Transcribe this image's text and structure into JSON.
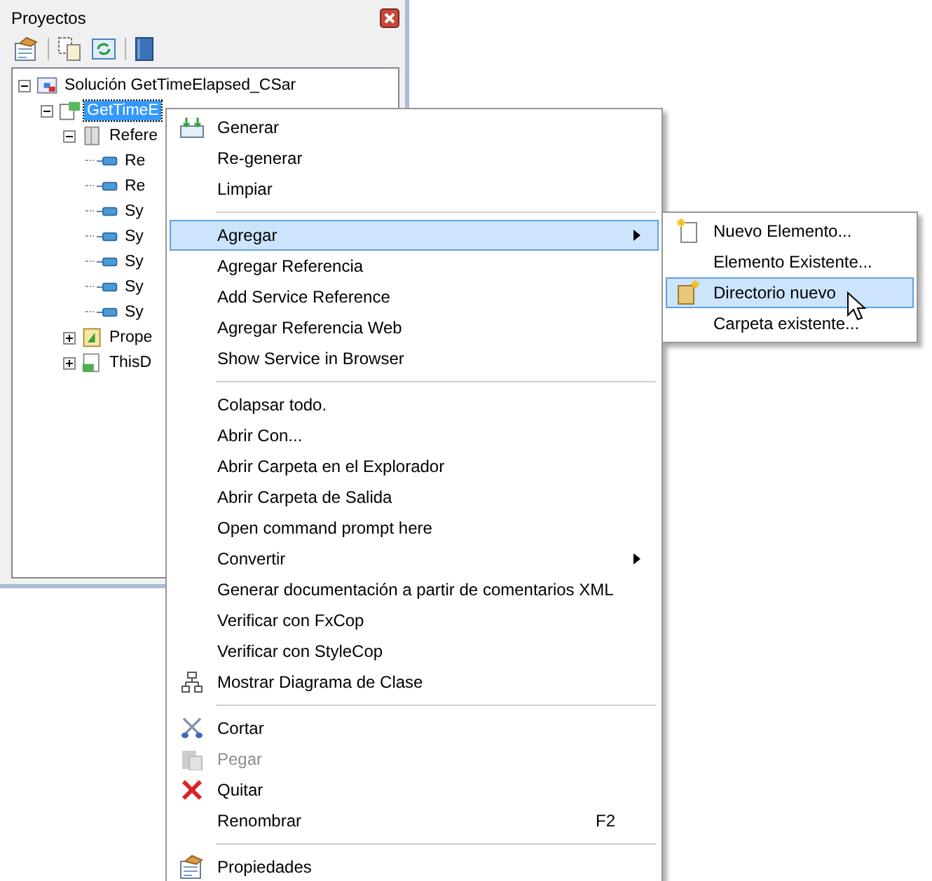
{
  "panel": {
    "title": "Proyectos"
  },
  "tree": [
    {
      "label": "Solución GetTimeElapsed_CSar",
      "kind": "solution",
      "expanded": true,
      "selected": false,
      "children": [
        {
          "label": "GetTimeE",
          "kind": "project",
          "expanded": true,
          "selected": true,
          "children": [
            {
              "label": "Refere",
              "kind": "references",
              "expanded": true,
              "selected": false,
              "children": [
                {
                  "label": "Re",
                  "kind": "reference",
                  "selected": false
                },
                {
                  "label": "Re",
                  "kind": "reference",
                  "selected": false
                },
                {
                  "label": "Sy",
                  "kind": "reference",
                  "selected": false
                },
                {
                  "label": "Sy",
                  "kind": "reference",
                  "selected": false
                },
                {
                  "label": "Sy",
                  "kind": "reference",
                  "selected": false
                },
                {
                  "label": "Sy",
                  "kind": "reference",
                  "selected": false
                },
                {
                  "label": "Sy",
                  "kind": "reference",
                  "selected": false
                }
              ]
            },
            {
              "label": "Prope",
              "kind": "properties",
              "expanded": false,
              "selected": false
            },
            {
              "label": "ThisD",
              "kind": "codefile",
              "expanded": false,
              "selected": false
            }
          ]
        }
      ]
    }
  ],
  "context_menu": [
    {
      "kind": "item",
      "label": "Generar",
      "selected": false,
      "disabled": false,
      "submenu": false
    },
    {
      "kind": "item",
      "label": "Re-generar",
      "selected": false,
      "disabled": false,
      "submenu": false
    },
    {
      "kind": "item",
      "label": "Limpiar",
      "selected": false,
      "disabled": false,
      "submenu": false
    },
    {
      "kind": "separator"
    },
    {
      "kind": "item",
      "label": "Agregar",
      "selected": true,
      "disabled": false,
      "submenu": true
    },
    {
      "kind": "item",
      "label": "Agregar Referencia",
      "selected": false,
      "disabled": false,
      "submenu": false
    },
    {
      "kind": "item",
      "label": "Add Service Reference",
      "selected": false,
      "disabled": false,
      "submenu": false
    },
    {
      "kind": "item",
      "label": "Agregar Referencia Web",
      "selected": false,
      "disabled": false,
      "submenu": false
    },
    {
      "kind": "item",
      "label": "Show Service in Browser",
      "selected": false,
      "disabled": false,
      "submenu": false
    },
    {
      "kind": "separator"
    },
    {
      "kind": "item",
      "label": "Colapsar todo.",
      "selected": false,
      "disabled": false,
      "submenu": false
    },
    {
      "kind": "item",
      "label": "Abrir Con...",
      "selected": false,
      "disabled": false,
      "submenu": false
    },
    {
      "kind": "item",
      "label": "Abrir Carpeta en el Explorador",
      "selected": false,
      "disabled": false,
      "submenu": false
    },
    {
      "kind": "item",
      "label": "Abrir Carpeta de Salida",
      "selected": false,
      "disabled": false,
      "submenu": false
    },
    {
      "kind": "item",
      "label": "Open command prompt here",
      "selected": false,
      "disabled": false,
      "submenu": false
    },
    {
      "kind": "item",
      "label": "Convertir",
      "selected": false,
      "disabled": false,
      "submenu": true
    },
    {
      "kind": "item",
      "label": "Generar documentación a partir de comentarios XML",
      "selected": false,
      "disabled": false,
      "submenu": false
    },
    {
      "kind": "item",
      "label": "Verificar con FxCop",
      "selected": false,
      "disabled": false,
      "submenu": false
    },
    {
      "kind": "item",
      "label": "Verificar con StyleCop",
      "selected": false,
      "disabled": false,
      "submenu": false
    },
    {
      "kind": "item",
      "label": "Mostrar Diagrama de Clase",
      "selected": false,
      "disabled": false,
      "submenu": false
    },
    {
      "kind": "separator"
    },
    {
      "kind": "item",
      "label": "Cortar",
      "selected": false,
      "disabled": false,
      "submenu": false
    },
    {
      "kind": "item",
      "label": "Pegar",
      "selected": false,
      "disabled": true,
      "submenu": false
    },
    {
      "kind": "item",
      "label": "Quitar",
      "selected": false,
      "disabled": false,
      "submenu": false
    },
    {
      "kind": "item",
      "label": "Renombrar",
      "shortcut": "F2",
      "selected": false,
      "disabled": false,
      "submenu": false
    },
    {
      "kind": "separator"
    },
    {
      "kind": "item",
      "label": "Propiedades",
      "selected": false,
      "disabled": false,
      "submenu": false
    }
  ],
  "submenu": [
    {
      "label": "Nuevo Elemento...",
      "selected": false
    },
    {
      "label": "Elemento Existente...",
      "selected": false
    },
    {
      "label": "Directorio nuevo",
      "selected": true
    },
    {
      "label": "Carpeta existente...",
      "selected": false
    }
  ]
}
